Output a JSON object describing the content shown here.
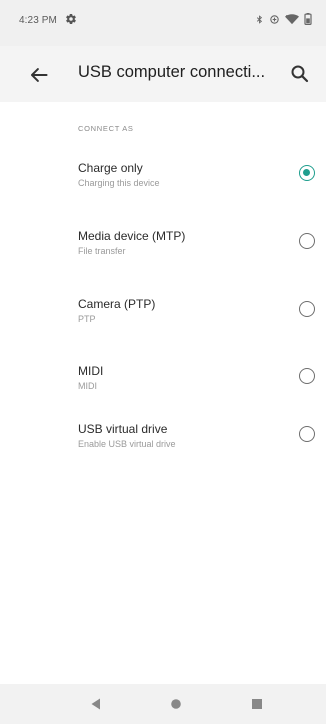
{
  "status_bar": {
    "time": "4:23 PM",
    "icons": [
      "settings-gear-icon",
      "bluetooth-icon",
      "data-saver-icon",
      "wifi-icon",
      "battery-icon"
    ]
  },
  "app_bar": {
    "title": "USB computer connecti...",
    "back_icon": "arrow-back-icon",
    "search_icon": "search-icon"
  },
  "section": {
    "header": "CONNECT AS"
  },
  "options": [
    {
      "title": "Charge only",
      "subtitle": "Charging this device",
      "selected": true
    },
    {
      "title": "Media device (MTP)",
      "subtitle": "File transfer",
      "selected": false
    },
    {
      "title": "Camera (PTP)",
      "subtitle": "PTP",
      "selected": false
    },
    {
      "title": "MIDI",
      "subtitle": "MIDI",
      "selected": false
    },
    {
      "title": "USB virtual drive",
      "subtitle": "Enable USB virtual drive",
      "selected": false
    }
  ],
  "nav_bar": {
    "icons": [
      "nav-back-icon",
      "nav-home-icon",
      "nav-recents-icon"
    ]
  },
  "colors": {
    "accent": "#1f9e8e",
    "status_bar_bg": "#f0f0f0",
    "app_bar_bg": "#f4f4f4",
    "nav_bar_bg": "#f2f2f2"
  }
}
